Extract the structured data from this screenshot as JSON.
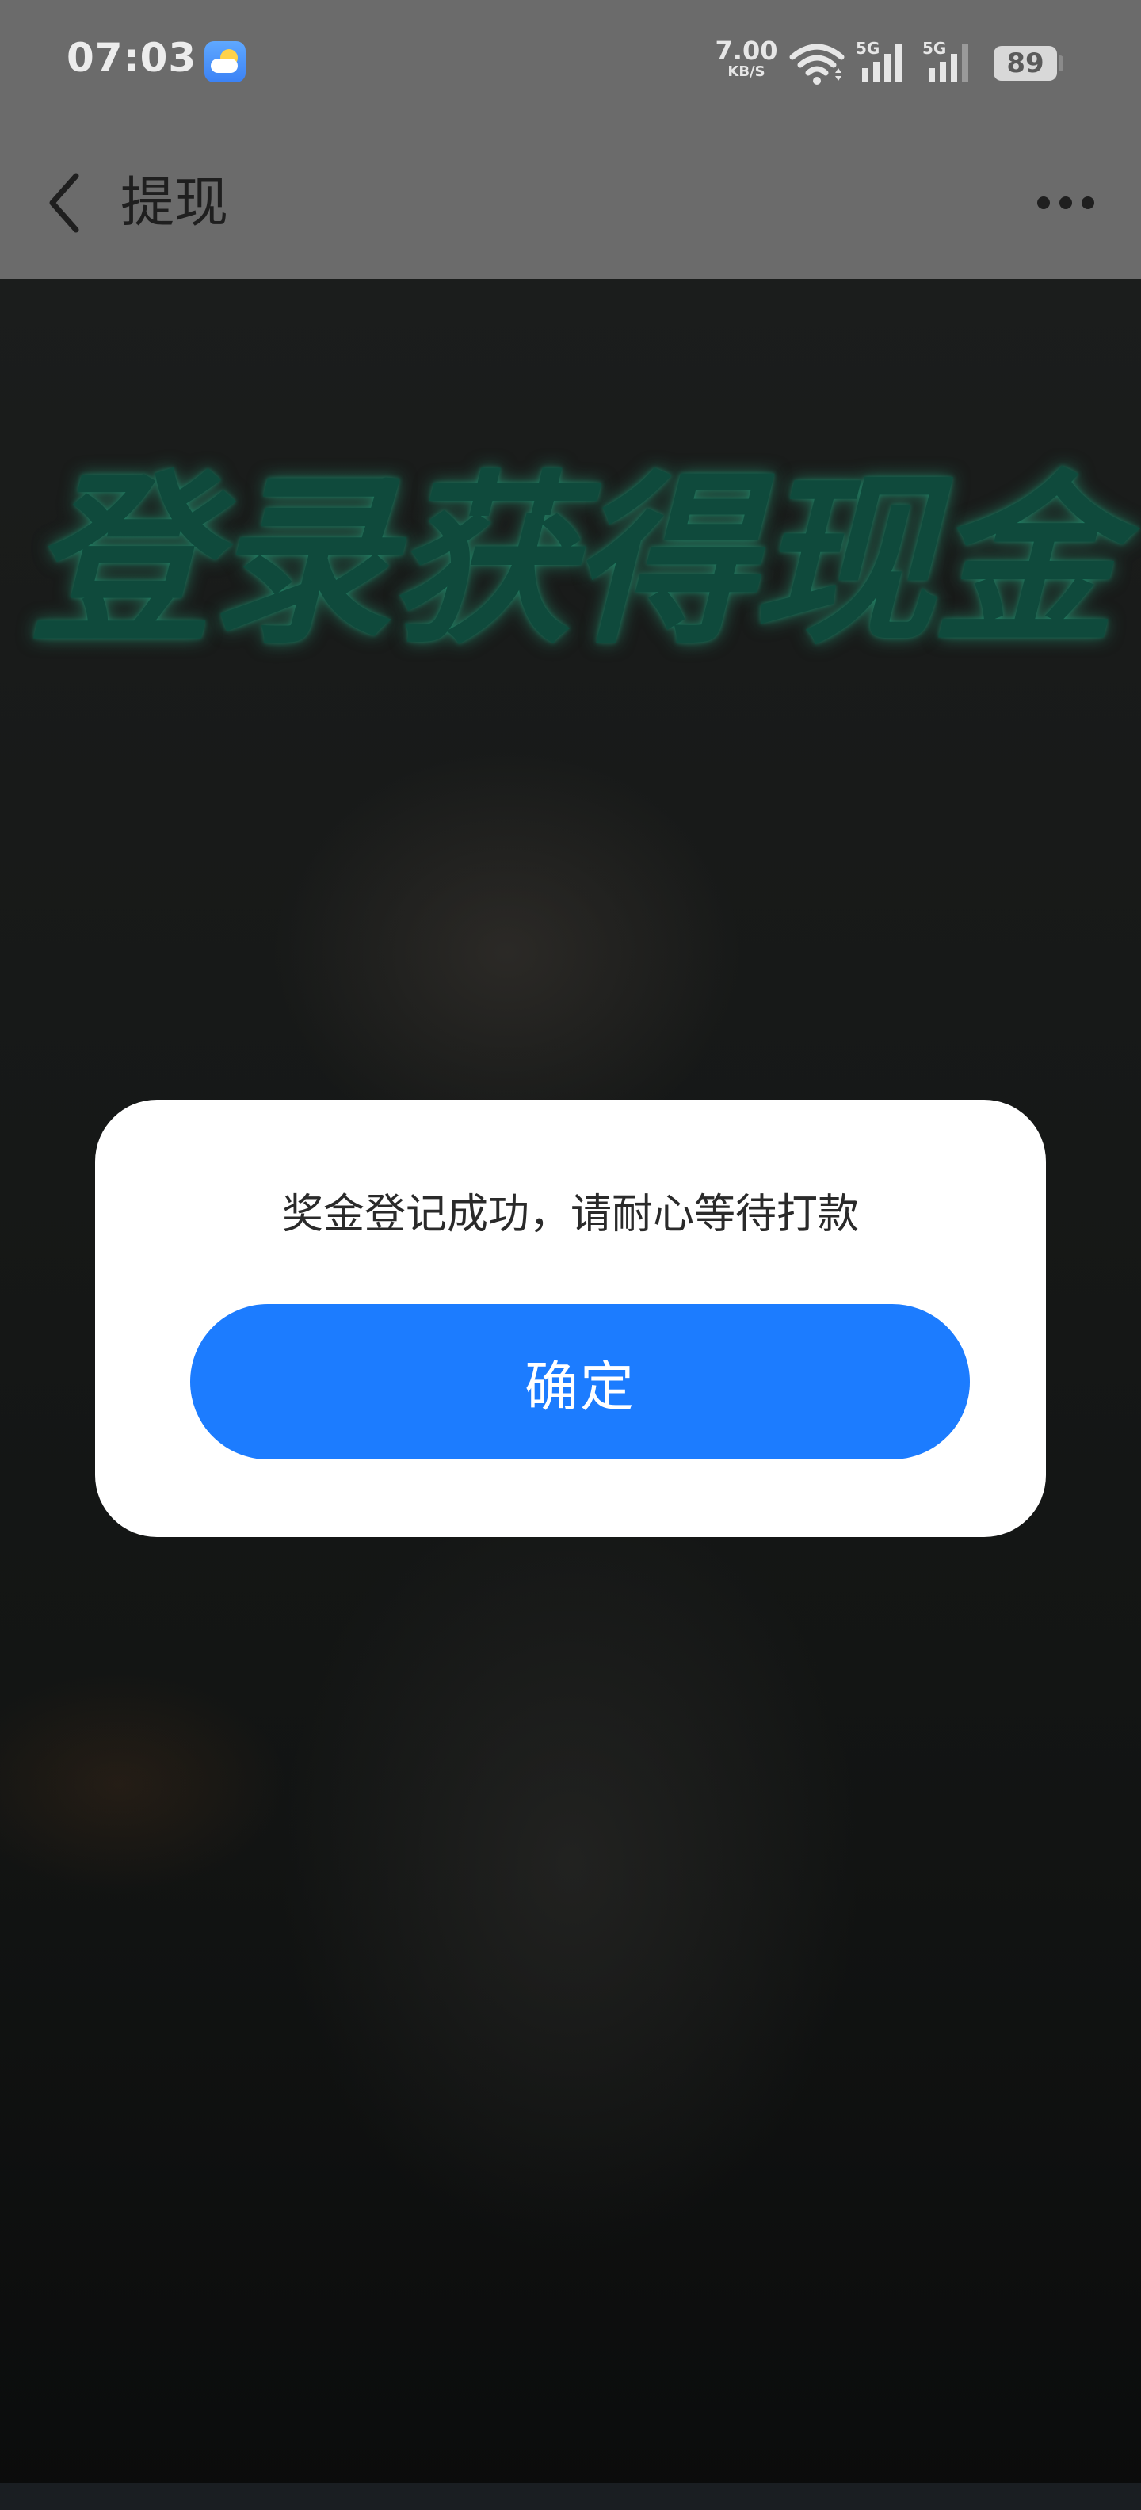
{
  "status_bar": {
    "time": "07:03",
    "net_speed_value": "7.00",
    "net_speed_unit": "KB/S",
    "network_1": "5G",
    "network_2": "5G",
    "battery_level": "89",
    "icons": [
      "weather-icon",
      "wifi-icon",
      "signal-icon",
      "battery-icon"
    ]
  },
  "nav": {
    "title": "提现",
    "back_icon": "chevron-left-icon",
    "more_icon": "more-dots-icon"
  },
  "background": {
    "promo_title": "登录获得现金"
  },
  "dialog": {
    "message": "奖金登记成功，请耐心等待打款",
    "confirm_label": "确定",
    "accent_color": "#1c7cff"
  }
}
